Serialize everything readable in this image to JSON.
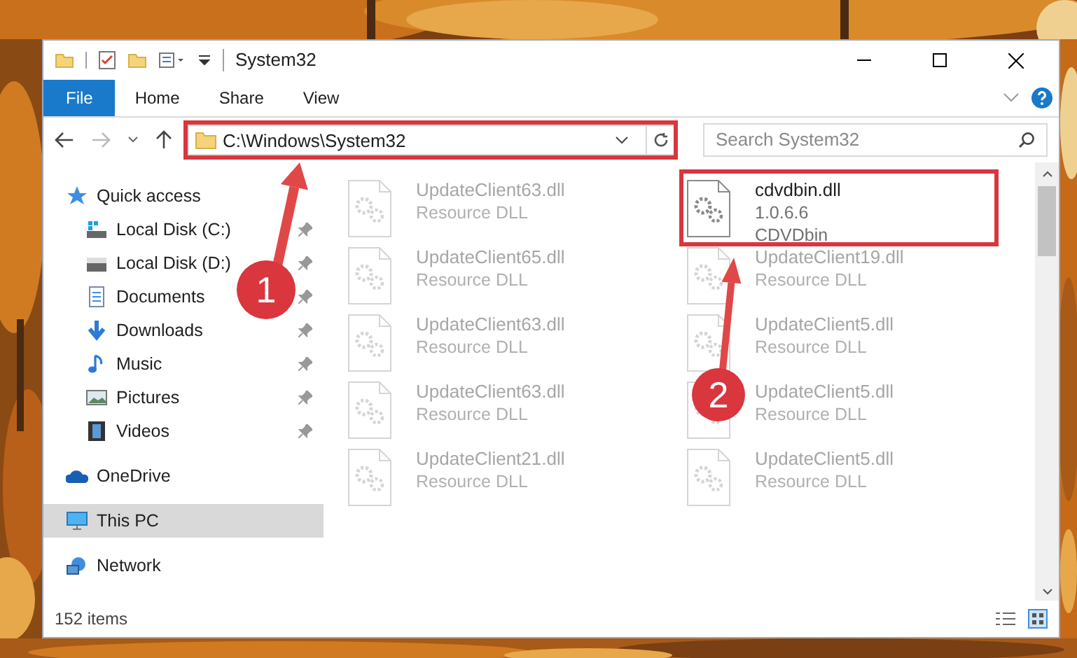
{
  "window": {
    "title": "System32"
  },
  "ribbon_tabs": [
    {
      "label": "File",
      "selected": true
    },
    {
      "label": "Home",
      "selected": false
    },
    {
      "label": "Share",
      "selected": false
    },
    {
      "label": "View",
      "selected": false
    }
  ],
  "address_bar": {
    "value": "C:\\Windows\\System32",
    "highlighted": true
  },
  "search": {
    "placeholder": "Search System32"
  },
  "sidebar": {
    "items": [
      {
        "label": "Quick access",
        "selected": false,
        "children": [
          {
            "label": "Local Disk (C:)",
            "pinned": true,
            "selected": false
          },
          {
            "label": "Local Disk (D:)",
            "pinned": true,
            "selected": false
          },
          {
            "label": "Documents",
            "pinned": true,
            "selected": false
          },
          {
            "label": "Downloads",
            "pinned": true,
            "selected": false
          },
          {
            "label": "Music",
            "pinned": true,
            "selected": false
          },
          {
            "label": "Pictures",
            "pinned": true,
            "selected": false
          },
          {
            "label": "Videos",
            "pinned": true,
            "selected": false
          }
        ]
      },
      {
        "label": "OneDrive",
        "selected": false
      },
      {
        "label": "This PC",
        "selected": true
      },
      {
        "label": "Network",
        "selected": false
      }
    ]
  },
  "files": [
    {
      "name": "UpdateClient63.dll",
      "details": [
        "Resource DLL"
      ],
      "faded": true,
      "highlighted": false
    },
    {
      "name": "cdvdbin.dll",
      "details": [
        "1.0.6.6",
        "CDVDbin"
      ],
      "faded": false,
      "highlighted": true
    },
    {
      "name": "UpdateClient65.dll",
      "details": [
        "Resource DLL"
      ],
      "faded": true,
      "highlighted": false
    },
    {
      "name": "UpdateClient19.dll",
      "details": [
        "Resource DLL"
      ],
      "faded": true,
      "highlighted": false
    },
    {
      "name": "UpdateClient63.dll",
      "details": [
        "Resource DLL"
      ],
      "faded": true,
      "highlighted": false
    },
    {
      "name": "UpdateClient5.dll",
      "details": [
        "Resource DLL"
      ],
      "faded": true,
      "highlighted": false
    },
    {
      "name": "UpdateClient63.dll",
      "details": [
        "Resource DLL"
      ],
      "faded": true,
      "highlighted": false
    },
    {
      "name": "UpdateClient5.dll",
      "details": [
        "Resource DLL"
      ],
      "faded": true,
      "highlighted": false
    },
    {
      "name": "UpdateClient21.dll",
      "details": [
        "Resource DLL"
      ],
      "faded": true,
      "highlighted": false
    },
    {
      "name": "UpdateClient5.dll",
      "details": [
        "Resource DLL"
      ],
      "faded": true,
      "highlighted": false
    }
  ],
  "status_bar": {
    "item_count": "152 items"
  },
  "annotations": [
    {
      "label": "1"
    },
    {
      "label": "2"
    }
  ]
}
